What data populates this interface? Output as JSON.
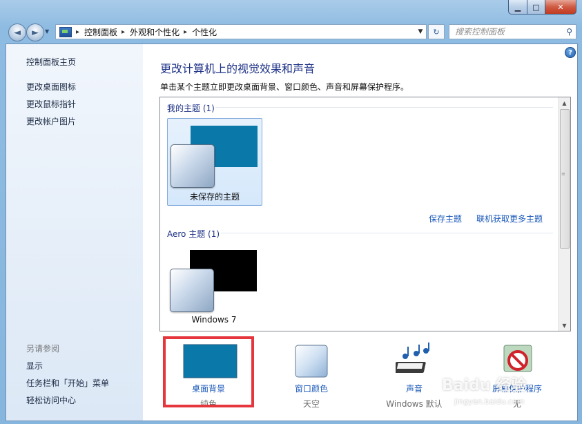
{
  "window": {
    "min_glyph": "▁",
    "max_glyph": "□",
    "close_glyph": "✕",
    "accent": "#0a78a8"
  },
  "nav": {
    "back_glyph": "◄",
    "fwd_glyph": "►",
    "history_glyph": "▼",
    "breadcrumbs": [
      "控制面板",
      "外观和个性化",
      "个性化"
    ],
    "crumb_sep": "▸",
    "dropdown_glyph": "▼",
    "refresh_glyph": "↻",
    "search_placeholder": "搜索控制面板",
    "search_glyph": "⚲"
  },
  "sidebar": {
    "home": "控制面板主页",
    "tasks": [
      "更改桌面图标",
      "更改鼠标指针",
      "更改帐户图片"
    ],
    "see_also_title": "另请参阅",
    "see_also": [
      "显示",
      "任务栏和「开始」菜单",
      "轻松访问中心"
    ]
  },
  "main": {
    "help_glyph": "?",
    "heading": "更改计算机上的视觉效果和声音",
    "subtitle": "单击某个主题立即更改桌面背景、窗口颜色、声音和屏幕保护程序。",
    "my_themes": {
      "title": "我的主题 (1)",
      "items": [
        {
          "name": "未保存的主题",
          "bg_color": "#0a78a8",
          "selected": true
        }
      ],
      "save_link": "保存主题",
      "online_link": "联机获取更多主题"
    },
    "aero_themes": {
      "title": "Aero 主题 (1)",
      "items": [
        {
          "name": "Windows 7",
          "bg_color": "#000000",
          "selected": false
        }
      ]
    },
    "scroll_up_glyph": "▲",
    "scroll_down_glyph": "▼",
    "scroll_grip": "≡"
  },
  "settings": [
    {
      "label": "桌面背景",
      "value": "纯色",
      "icon": "desktop-background-icon"
    },
    {
      "label": "窗口颜色",
      "value": "天空",
      "icon": "window-color-icon"
    },
    {
      "label": "声音",
      "value": "Windows 默认",
      "icon": "sound-icon"
    },
    {
      "label": "屏幕保护程序",
      "value": "无",
      "icon": "screensaver-icon"
    }
  ],
  "watermark": {
    "text": "Baidu 经验",
    "url": "jingyan.baidu.com"
  }
}
